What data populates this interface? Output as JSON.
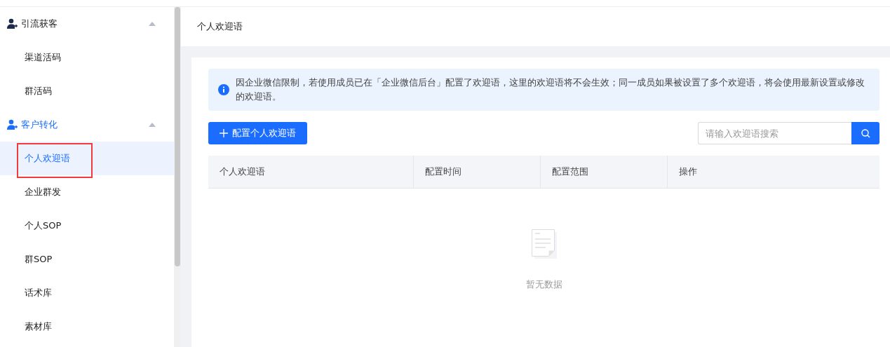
{
  "sidebar": {
    "groups": [
      {
        "label": "引流获客",
        "active": false,
        "expanded": true,
        "items": [
          {
            "label": "渠道活码",
            "selected": false,
            "outlined": false
          },
          {
            "label": "群活码",
            "selected": false,
            "outlined": false
          }
        ]
      },
      {
        "label": "客户转化",
        "active": true,
        "expanded": true,
        "items": [
          {
            "label": "个人欢迎语",
            "selected": true,
            "outlined": true
          },
          {
            "label": "企业群发",
            "selected": false,
            "outlined": false
          },
          {
            "label": "个人SOP",
            "selected": false,
            "outlined": false
          },
          {
            "label": "群SOP",
            "selected": false,
            "outlined": false
          },
          {
            "label": "话术库",
            "selected": false,
            "outlined": false
          },
          {
            "label": "素材库",
            "selected": false,
            "outlined": false
          }
        ]
      }
    ]
  },
  "page_title": "个人欢迎语",
  "notice": "因企业微信限制，若使用成员已在「企业微信后台」配置了欢迎语，这里的欢迎语将不会生效；同一成员如果被设置了多个欢迎语，将会使用最新设置或修改的欢迎语。",
  "add_button": "配置个人欢迎语",
  "search": {
    "placeholder": "请输入欢迎语搜索"
  },
  "table": {
    "columns": [
      "个人欢迎语",
      "配置时间",
      "配置范围",
      "操作"
    ],
    "empty_text": "暂无数据"
  }
}
